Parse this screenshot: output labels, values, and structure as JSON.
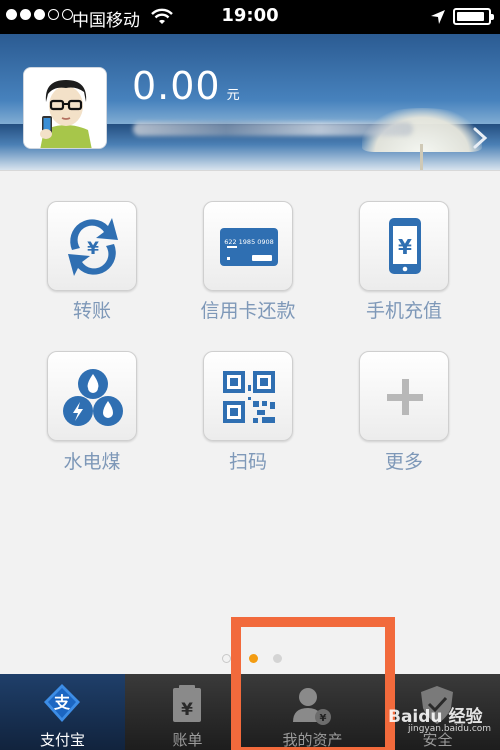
{
  "status_bar": {
    "carrier": "中国移动",
    "time": "19:00",
    "signal_dots": [
      true,
      true,
      true,
      false,
      false
    ],
    "battery_level": 0.9
  },
  "header": {
    "balance_amount": "0.00",
    "balance_unit": "元"
  },
  "services": [
    {
      "label": "转账",
      "icon": "transfer-icon",
      "color": "#2f6fb2"
    },
    {
      "label": "信用卡还款",
      "icon": "credit-card-icon",
      "color": "#2f6fb2",
      "card_number": "622 1985 0908"
    },
    {
      "label": "手机充值",
      "icon": "phone-recharge-icon",
      "color": "#2f6fb2"
    },
    {
      "label": "水电煤",
      "icon": "utilities-icon",
      "color": "#2f6fb2"
    },
    {
      "label": "扫码",
      "icon": "qr-code-icon",
      "color": "#2f6fb2"
    },
    {
      "label": "更多",
      "icon": "plus-icon",
      "color": "#b8b8b8"
    }
  ],
  "pager": {
    "pages": 3,
    "active": 1,
    "active_color": "#f39c12"
  },
  "tabs": [
    {
      "label": "支付宝",
      "icon": "alipay-icon",
      "active": true
    },
    {
      "label": "账单",
      "icon": "bill-icon",
      "active": false
    },
    {
      "label": "我的资产",
      "icon": "my-assets-icon",
      "active": false
    },
    {
      "label": "安全",
      "icon": "security-shield-icon",
      "active": false
    }
  ],
  "annotation": {
    "highlight_color": "#f26a3c",
    "target_tab": "我的资产"
  },
  "watermark": {
    "text": "Baidu 经验",
    "sub": "jingyan.baidu.com"
  }
}
